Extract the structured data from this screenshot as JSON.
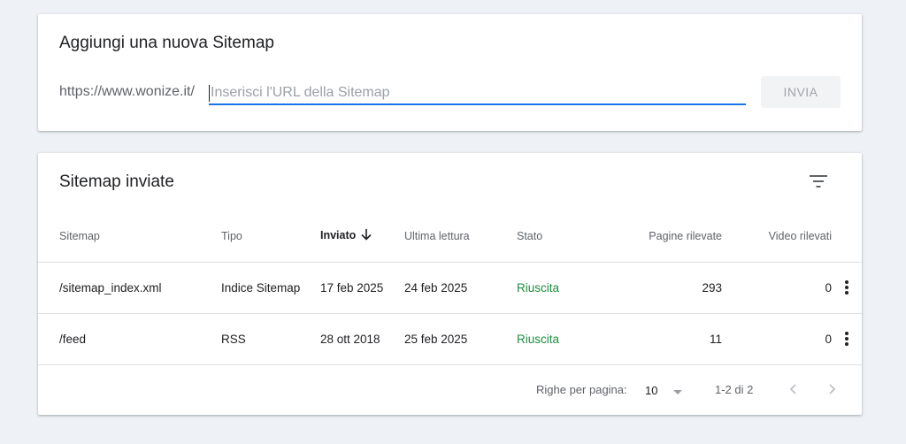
{
  "add_sitemap": {
    "title": "Aggiungi una nuova Sitemap",
    "prefix": "https://www.wonize.it/",
    "input_value": "",
    "input_placeholder": "Inserisci l'URL della Sitemap",
    "submit_label": "INVIA"
  },
  "submitted": {
    "title": "Sitemap inviate",
    "filter_icon": "filter-icon",
    "columns": [
      "Sitemap",
      "Tipo",
      "Inviato",
      "Ultima lettura",
      "Stato",
      "Pagine rilevate",
      "Video rilevati"
    ],
    "sorted_column": "Inviato",
    "sort_direction": "desc",
    "rows": [
      {
        "sitemap": "/sitemap_index.xml",
        "tipo": "Indice Sitemap",
        "inviato": "17 feb 2025",
        "ultima_lettura": "24 feb 2025",
        "stato": "Riuscita",
        "pagine": "293",
        "video": "0"
      },
      {
        "sitemap": "/feed",
        "tipo": "RSS",
        "inviato": "28 ott 2018",
        "ultima_lettura": "25 feb 2025",
        "stato": "Riuscita",
        "pagine": "11",
        "video": "0"
      }
    ],
    "pagination": {
      "rows_per_page_label": "Righe per pagina:",
      "rows_per_page": "10",
      "range": "1-2 di 2"
    }
  },
  "colors": {
    "accent": "#1a73e8",
    "success": "#1e8e3e",
    "background": "#eef2f7"
  }
}
